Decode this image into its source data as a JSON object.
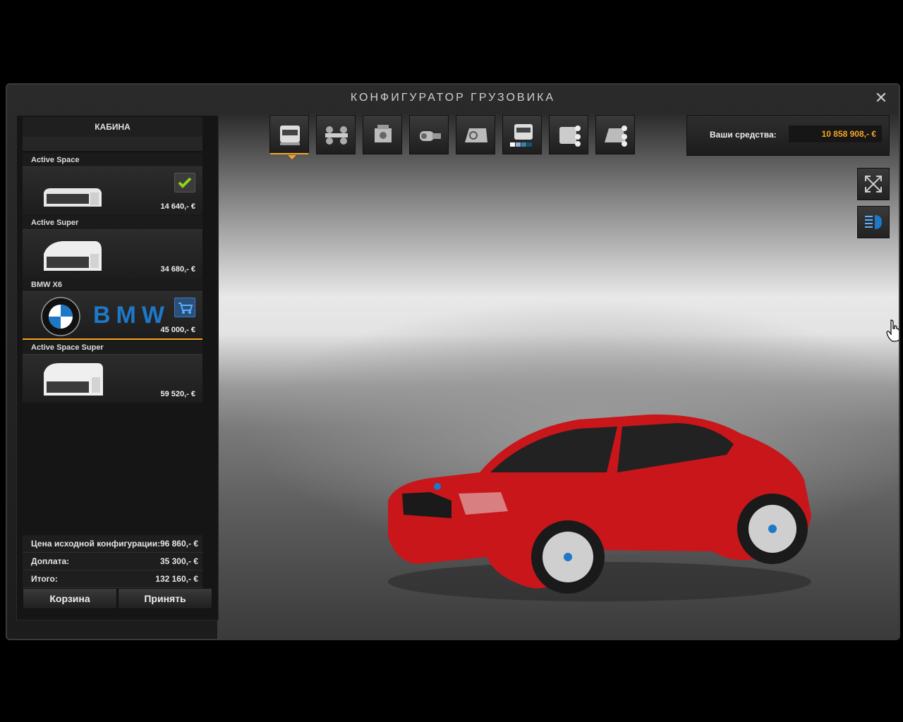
{
  "window": {
    "title": "КОНФИГУРАТОР ГРУЗОВИКА"
  },
  "panel": {
    "header": "КАБИНА",
    "items": [
      {
        "name": "Active Space",
        "price": "14 640,- €",
        "status": "owned"
      },
      {
        "name": "Active Super",
        "price": "34 680,- €",
        "status": "available"
      },
      {
        "name": "BMW X6",
        "price": "45 000,- €",
        "status": "in-cart",
        "brand_text": "BMW"
      },
      {
        "name": "Active Space Super",
        "price": "59 520,- €",
        "status": "available"
      }
    ]
  },
  "summary": {
    "base_label": "Цена исходной конфигурации:",
    "base_value": "96 860,- €",
    "extra_label": "Доплата:",
    "extra_value": "35 300,- €",
    "total_label": "Итого:",
    "total_value": "132 160,- €"
  },
  "buttons": {
    "cart": "Корзина",
    "accept": "Принять"
  },
  "funds": {
    "label": "Ваши средства:",
    "value": "10 858 908,- €"
  },
  "tabs": [
    "cabin-icon",
    "chassis-icon",
    "engine-icon",
    "transmission-icon",
    "interior-icon",
    "paint-icon",
    "accessories-icon",
    "lights-icon"
  ],
  "colors": {
    "accent": "#f5a623",
    "car": "#c8161b",
    "check": "#8fd11a",
    "blue": "#1e78c8"
  }
}
